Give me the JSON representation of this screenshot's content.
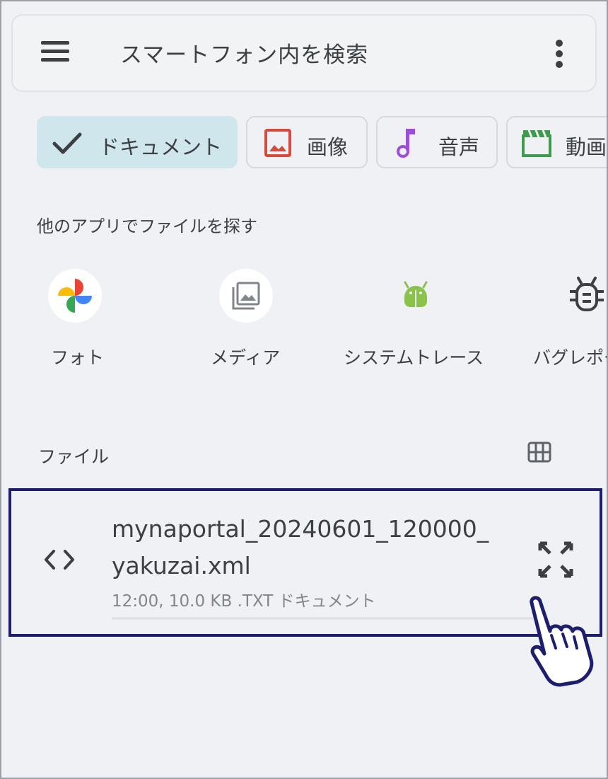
{
  "search_bar": {
    "placeholder": "スマートフォン内を検索",
    "menu_icon": "hamburger-menu-icon",
    "more_icon": "more-vert-icon"
  },
  "filter_chips": [
    {
      "label": "ドキュメント",
      "icon": "check-icon",
      "selected": true
    },
    {
      "label": "画像",
      "icon": "image-icon",
      "selected": false
    },
    {
      "label": "音声",
      "icon": "music-note-icon",
      "selected": false
    },
    {
      "label": "動画",
      "icon": "video-clapper-icon",
      "selected": false
    }
  ],
  "other_apps": {
    "title": "他のアプリでファイルを探す",
    "apps": [
      {
        "label": "フォト",
        "icon": "google-photos-icon"
      },
      {
        "label": "メディア",
        "icon": "media-gallery-icon"
      },
      {
        "label": "システムトレース",
        "icon": "android-icon"
      },
      {
        "label": "バグレポート",
        "icon": "bug-icon"
      }
    ]
  },
  "files": {
    "title": "ファイル",
    "view_toggle_icon": "grid-view-icon",
    "items": [
      {
        "name": "mynaportal_20240601_120000_yakuzai.xml",
        "meta": "12:00, 10.0 KB .TXT ドキュメント",
        "type_icon": "code-icon",
        "action_icon": "expand-icon"
      }
    ]
  },
  "colors": {
    "background": "#eff1f4",
    "chip_selected": "#d0e6ed",
    "highlight_border": "#1e1e6e",
    "image_icon": "#d9483b",
    "audio_icon": "#9c4fd6",
    "video_icon": "#3e9a4c",
    "android_icon": "#8bc34a"
  }
}
